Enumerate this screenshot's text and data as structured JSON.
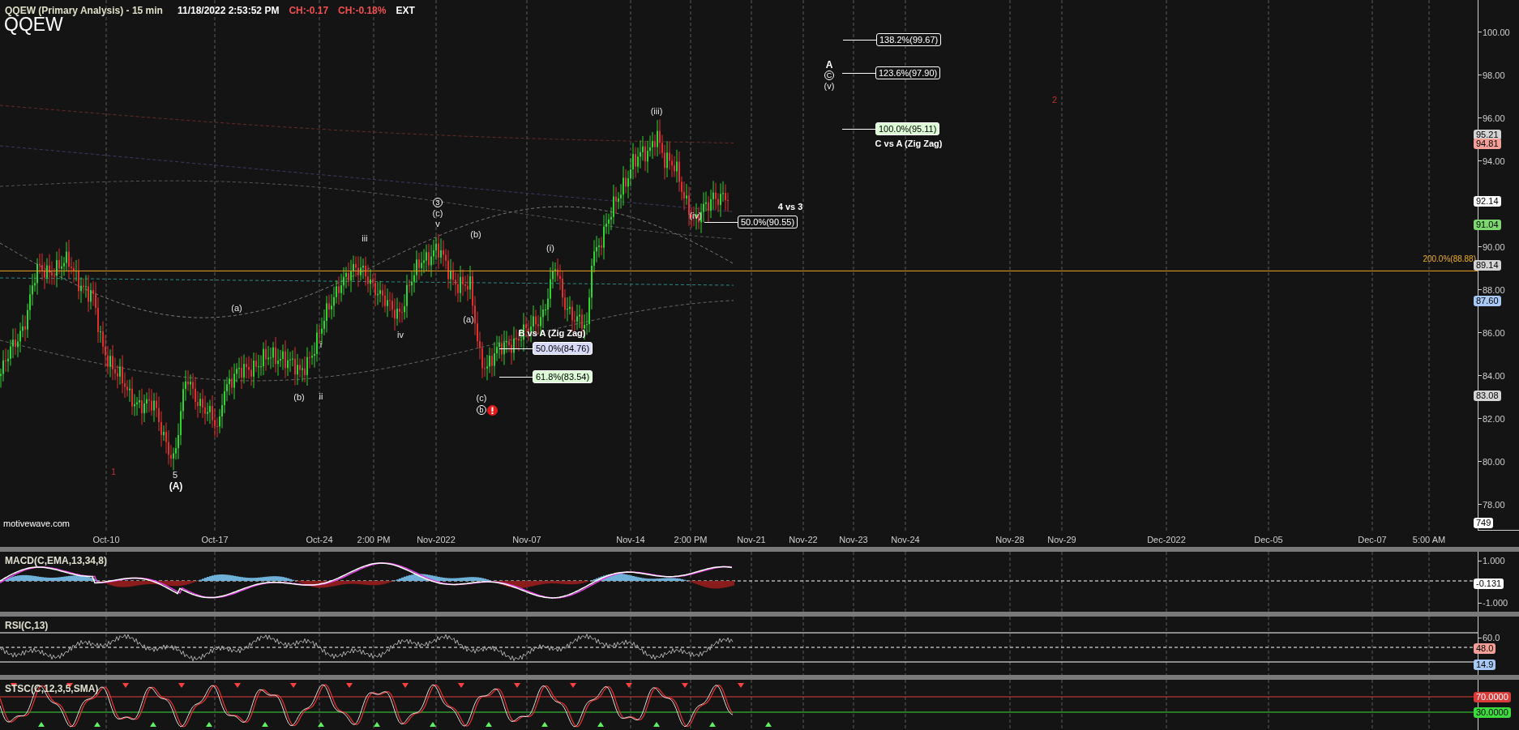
{
  "header": {
    "title": "QQEW (Primary Analysis) - 15 min",
    "timestamp": "11/18/2022 2:53:52 PM",
    "change": "CH:-0.17",
    "change_percent": "CH:-0.18%",
    "session": "EXT",
    "symbol": "QQEW"
  },
  "price_chart": {
    "wave_labels": [
      {
        "text": "1",
        "kind": "degree",
        "warning": false
      },
      {
        "text": "5",
        "kind": "plain",
        "warning": false
      },
      {
        "text": "(A)",
        "kind": "bold",
        "warning": false
      },
      {
        "text": "(a)",
        "kind": "plain",
        "warning": false
      },
      {
        "text": "(b)",
        "kind": "plain",
        "warning": false
      },
      {
        "text": "i",
        "kind": "plain",
        "warning": false
      },
      {
        "text": "ii",
        "kind": "plain",
        "warning": false
      },
      {
        "text": "iii",
        "kind": "plain",
        "warning": false
      },
      {
        "text": "iv",
        "kind": "plain",
        "warning": false
      },
      {
        "text": "3",
        "kind": "circled",
        "warning": false
      },
      {
        "text": "(c)",
        "kind": "plain",
        "warning": false
      },
      {
        "text": "v",
        "kind": "plain",
        "warning": false
      },
      {
        "text": "(a)",
        "kind": "plain",
        "warning": false
      },
      {
        "text": "(b)",
        "kind": "plain",
        "warning": false
      },
      {
        "text": "(c)",
        "kind": "plain",
        "warning": false
      },
      {
        "text": "b",
        "kind": "circled",
        "warning": true
      },
      {
        "text": "(i)",
        "kind": "plain",
        "warning": false
      },
      {
        "text": "(iii)",
        "kind": "plain",
        "warning": false
      },
      {
        "text": "(iv)",
        "kind": "plain",
        "warning": false
      },
      {
        "text": "A",
        "kind": "bold",
        "warning": false
      },
      {
        "text": "C",
        "kind": "circled",
        "warning": false
      },
      {
        "text": "(v)",
        "kind": "plain",
        "warning": false
      },
      {
        "text": "2",
        "kind": "degree",
        "warning": false
      }
    ],
    "projections": [
      {
        "label": "138.2%(99.67)",
        "color": "#141414"
      },
      {
        "label": "123.6%(97.90)",
        "color": "#141414"
      },
      {
        "label": "100.0%(95.11)",
        "color": "#dcfcd6"
      },
      {
        "label": "50.0%(90.55)",
        "color": "#141414"
      },
      {
        "label": "50.0%(84.76)",
        "color": "#d8dafa"
      },
      {
        "label": "61.8%(83.54)",
        "color": "#dcfad6"
      }
    ],
    "annotations": [
      "C vs A (Zig Zag)",
      "4 vs 3",
      "B vs A (Zig Zag)"
    ],
    "extension_label": "200.0%(88.88)",
    "y_ticks": [
      "100.00",
      "98.00",
      "96.00",
      "94.00",
      "90.00",
      "88.00",
      "86.00",
      "84.00",
      "82.00",
      "80.00",
      "78.00"
    ],
    "price_tags": [
      {
        "text": "95.21",
        "color": "#d4d4d4"
      },
      {
        "text": "94.81",
        "color": "#f4a098"
      },
      {
        "text": "92.14",
        "color": "#ffffff"
      },
      {
        "text": "91.04",
        "color": "#7ed870"
      },
      {
        "text": "89.14",
        "color": "#d4d4d4"
      },
      {
        "text": "87.60",
        "color": "#a8c8f4"
      },
      {
        "text": "83.08",
        "color": "#d4d4d4"
      },
      {
        "text": "749",
        "color": "#ffffff"
      }
    ],
    "source": "motivewave.com"
  },
  "x_axis": [
    "Oct-10",
    "Oct-17",
    "Oct-24",
    "2:00 PM",
    "Nov-2022",
    "Nov-07",
    "Nov-14",
    "2:00 PM",
    "Nov-21",
    "Nov-22",
    "Nov-23",
    "Nov-24",
    "Nov-28",
    "Nov-29",
    "Dec-2022",
    "Dec-05",
    "Dec-07",
    "5:00 AM"
  ],
  "indicators": [
    {
      "title": "MACD(C,EMA,13,34,8)",
      "kind": "macd",
      "ticks": [
        "1.000",
        "-1.000"
      ],
      "tags": [
        {
          "text": "-0.131",
          "color": "#ffffff"
        }
      ]
    },
    {
      "title": "RSI(C,13)",
      "kind": "rsi",
      "ticks": [
        "60.0"
      ],
      "tags": [
        {
          "text": "48.0",
          "color": "#f4a098"
        },
        {
          "text": "14.9",
          "color": "#a8c8f4"
        }
      ]
    },
    {
      "title": "STSC(C,12,3,5,SMA)",
      "kind": "stochastic",
      "tags": [
        {
          "text": "70.0000",
          "color": "#d93a3a"
        },
        {
          "text": "30.0000",
          "color": "#3ddc3d"
        }
      ]
    }
  ]
}
